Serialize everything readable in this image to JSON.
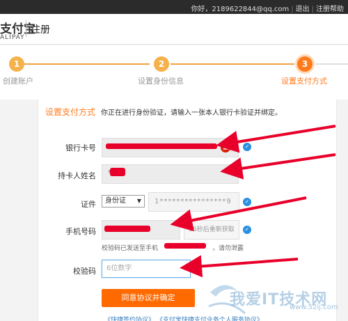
{
  "topbar": {
    "greeting": "你好，2189622844@qq.com",
    "logout": "退出",
    "help": "注册帮助"
  },
  "header": {
    "logo_cn": "支付宝",
    "logo_en": "ALIPAY",
    "page_title": "注册"
  },
  "steps": [
    {
      "number": "1",
      "label": "创建账户"
    },
    {
      "number": "2",
      "label": "设置身份信息"
    },
    {
      "number": "3",
      "label": "设置支付方式"
    }
  ],
  "intro": {
    "title": "设置支付方式",
    "text": "你正在进行身份验证，请输入一张本人银行卡验证并绑定。"
  },
  "form": {
    "bank_card_label": "银行卡号",
    "holder_label": "持卡人姓名",
    "holder_value": "*",
    "id_label": "证件",
    "id_type": "身份证",
    "id_number": "1****************9",
    "phone_label": "手机号码",
    "get_code_label": "55秒后重新获取",
    "sent_note": "校验码已发送至手机",
    "sent_note_tail": "，请勿泄露",
    "code_label": "校验码",
    "code_placeholder": "6位数字",
    "submit_label": "同意协议并确定",
    "footer_links": "《快捷签约协议》 《支付宝快捷支付业务个人服务协议》"
  },
  "watermark": {
    "text": "我爱IT技术网",
    "url": "www.52ij.com"
  },
  "colors": {
    "accent": "#ff7a1c",
    "redaction": "#e8002a",
    "check": "#2a8fe0",
    "annotation_arrow": "#e8002a"
  }
}
